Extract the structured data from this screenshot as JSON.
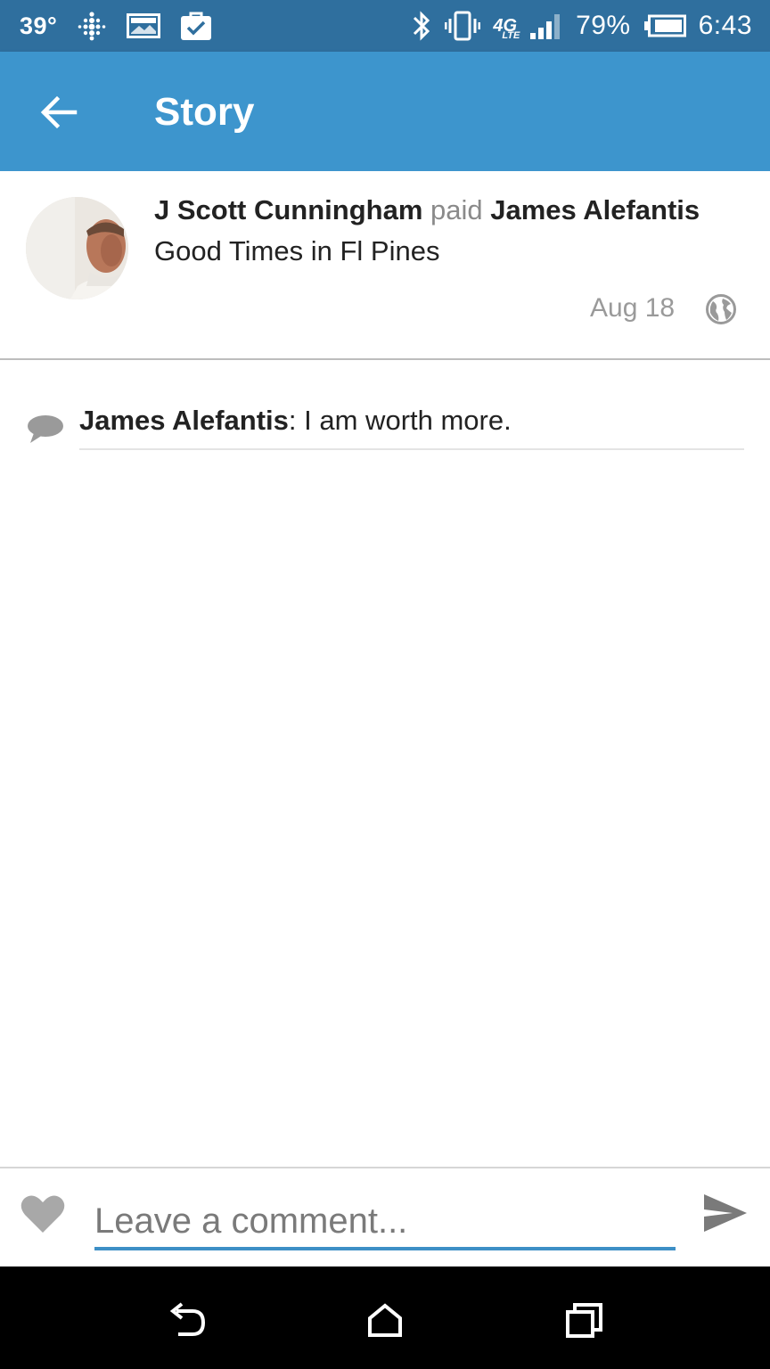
{
  "status_bar": {
    "temperature": "39°",
    "network_label": "4G",
    "network_sub": "LTE",
    "battery_percent": "79%",
    "time": "6:43",
    "icons": [
      "fitbit-icon",
      "image-icon",
      "briefcase-check-icon",
      "bluetooth-icon",
      "vibrate-icon",
      "signal-icon",
      "battery-icon"
    ]
  },
  "app_bar": {
    "title": "Story",
    "back_icon": "arrow-left-icon",
    "color": "#3d95cd"
  },
  "story": {
    "payer": "J Scott Cunningham",
    "verb": "paid",
    "payee": "James Alefantis",
    "note": "Good Times in Fl Pines",
    "date": "Aug 18",
    "audience_icon": "globe-icon"
  },
  "comments": [
    {
      "author": "James Alefantis",
      "separator": ":",
      "text": " I am worth more."
    }
  ],
  "composer": {
    "placeholder": "Leave a comment...",
    "like_icon": "heart-icon",
    "send_icon": "send-icon",
    "accent": "#3d8fc6"
  },
  "nav_bar": {
    "icons": [
      "back-icon",
      "home-icon",
      "recent-apps-icon"
    ]
  }
}
